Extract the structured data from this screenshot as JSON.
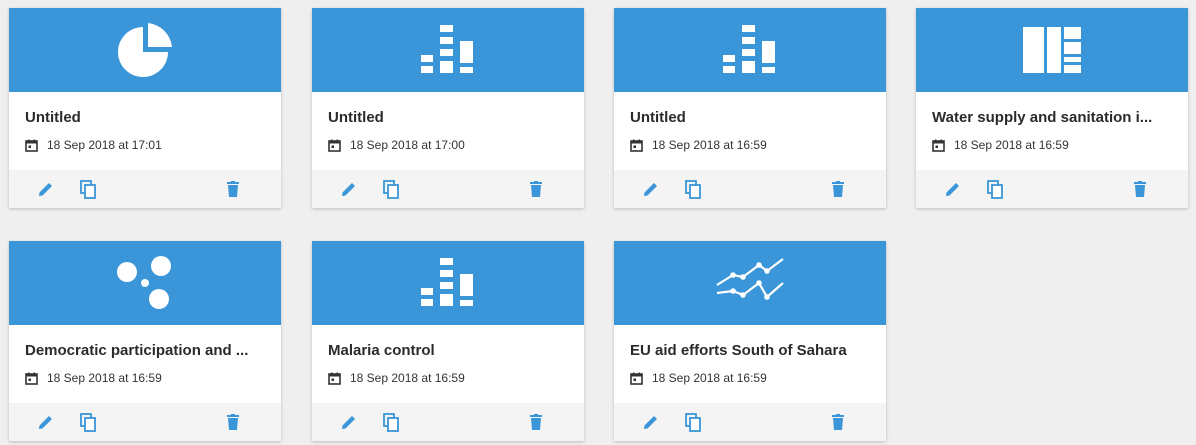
{
  "accent_color": "#3a96d8",
  "cards": [
    {
      "title": "Untitled",
      "date": "18 Sep 2018 at 17:01",
      "icon": "pie-chart-icon"
    },
    {
      "title": "Untitled",
      "date": "18 Sep 2018 at 17:00",
      "icon": "bar-chart-icon"
    },
    {
      "title": "Untitled",
      "date": "18 Sep 2018 at 16:59",
      "icon": "bar-chart-icon"
    },
    {
      "title": "Water supply and sanitation i...",
      "date": "18 Sep 2018 at 16:59",
      "icon": "treemap-icon"
    },
    {
      "title": "Democratic participation and ...",
      "date": "18 Sep 2018 at 16:59",
      "icon": "bubble-chart-icon"
    },
    {
      "title": "Malaria control",
      "date": "18 Sep 2018 at 16:59",
      "icon": "bar-chart-icon"
    },
    {
      "title": "EU aid efforts South of Sahara",
      "date": "18 Sep 2018 at 16:59",
      "icon": "line-chart-icon"
    }
  ],
  "actions": {
    "edit_icon": "pencil-icon",
    "copy_icon": "copy-icon",
    "delete_icon": "trash-icon"
  }
}
